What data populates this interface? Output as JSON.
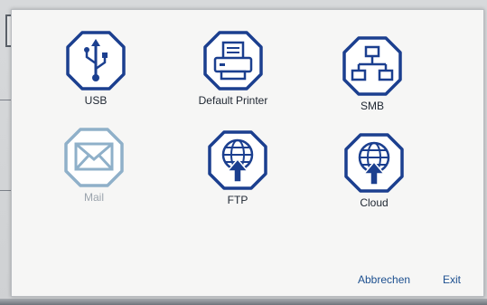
{
  "tiles": {
    "usb": {
      "label": "USB",
      "icon": "usb-icon",
      "enabled": true
    },
    "default_printer": {
      "label": "Default Printer",
      "icon": "printer-icon",
      "enabled": true
    },
    "smb": {
      "label": "SMB",
      "icon": "network-icon",
      "enabled": true
    },
    "mail": {
      "label": "Mail",
      "icon": "mail-icon",
      "enabled": false
    },
    "ftp": {
      "label": "FTP",
      "icon": "globe-upload-icon",
      "enabled": true
    },
    "cloud": {
      "label": "Cloud",
      "icon": "globe-upload-icon",
      "enabled": true
    }
  },
  "buttons": {
    "cancel": "Abbrechen",
    "exit": "Exit"
  },
  "colors": {
    "icon_blue": "#1b3f8f",
    "icon_disabled": "#8fb0c9",
    "dialog_bg": "#f6f6f5"
  }
}
